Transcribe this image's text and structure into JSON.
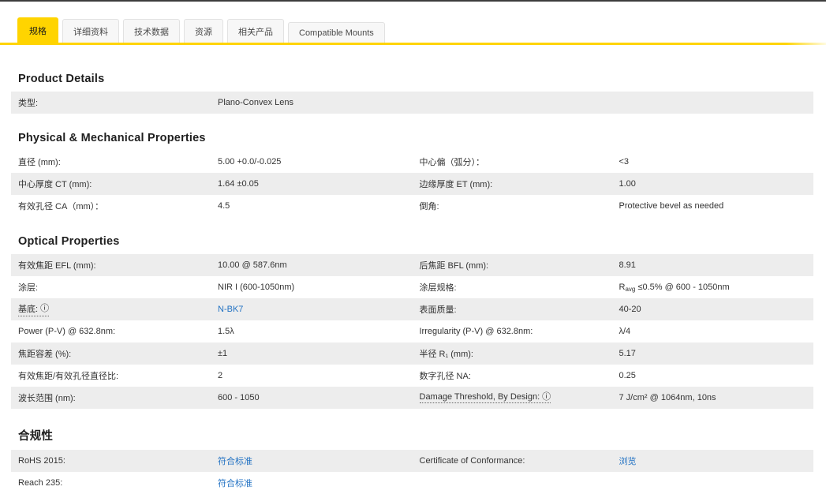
{
  "colors": {
    "accent_yellow": "#ffd400",
    "link_blue": "#2272c3",
    "row_gray": "#ededed"
  },
  "tabs": {
    "items": [
      {
        "label": "规格",
        "active": true
      },
      {
        "label": "详细资料",
        "active": false
      },
      {
        "label": "技术数据",
        "active": false
      },
      {
        "label": "资源",
        "active": false
      },
      {
        "label": "相关产品",
        "active": false
      },
      {
        "label": "Compatible Mounts",
        "active": false
      }
    ]
  },
  "product_details": {
    "title": "Product Details",
    "rows": [
      {
        "label": "类型:",
        "value": "Plano-Convex Lens"
      }
    ]
  },
  "physical": {
    "title": "Physical & Mechanical Properties",
    "rows": [
      {
        "left_label": "直径 (mm):",
        "left_value": "5.00 +0.0/-0.025",
        "right_label": "中心偏（弧分）：",
        "right_value": "<3"
      },
      {
        "left_label": "中心厚度 CT (mm):",
        "left_value": "1.64 ±0.05",
        "right_label": "边缘厚度 ET (mm):",
        "right_value": "1.00"
      },
      {
        "left_label": "有效孔径 CA（mm）：",
        "left_value": "4.5",
        "right_label": "倒角:",
        "right_value": "Protective bevel as needed"
      }
    ]
  },
  "optical": {
    "title": "Optical Properties",
    "rows": [
      {
        "left_label": "有效焦距 EFL (mm):",
        "left_value": "10.00 @ 587.6nm",
        "right_label": "后焦距 BFL (mm):",
        "right_value": "8.91"
      },
      {
        "left_label": "涂层:",
        "left_value": "NIR I (600-1050nm)",
        "right_label": "涂层规格:",
        "right_value_prefix": "R",
        "right_value_sub": "avg",
        "right_value_rest": " ≤0.5% @ 600 - 1050nm"
      },
      {
        "left_label": "基底:",
        "left_info_icon": "ⓘ",
        "left_value": "N-BK7",
        "right_label": "表面质量:",
        "right_value": "40-20"
      },
      {
        "left_label": "Power (P-V) @ 632.8nm:",
        "left_value": "1.5λ",
        "right_label": "Irregularity (P-V) @ 632.8nm:",
        "right_value": "λ/4"
      },
      {
        "left_label": "焦距容差 (%):",
        "left_value": "±1",
        "right_label": "半径 R₁ (mm):",
        "right_value": "5.17"
      },
      {
        "left_label": "有效焦距/有效孔径直径比:",
        "left_value": "2",
        "right_label": "数字孔径 NA:",
        "right_value": "0.25"
      },
      {
        "left_label": "波长范围 (nm):",
        "left_value": "600 - 1050",
        "right_label": "Damage Threshold, By Design:",
        "right_info_icon": "ⓘ",
        "right_value": "7 J/cm² @ 1064nm, 10ns"
      }
    ]
  },
  "compliance": {
    "title": "合规性",
    "rows": [
      {
        "left_label": "RoHS 2015:",
        "left_value": "符合标准",
        "right_label": "Certificate of Conformance:",
        "right_value": "浏览"
      },
      {
        "left_label": "Reach 235:",
        "left_value": "符合标准",
        "right_label": "",
        "right_value": ""
      }
    ]
  }
}
